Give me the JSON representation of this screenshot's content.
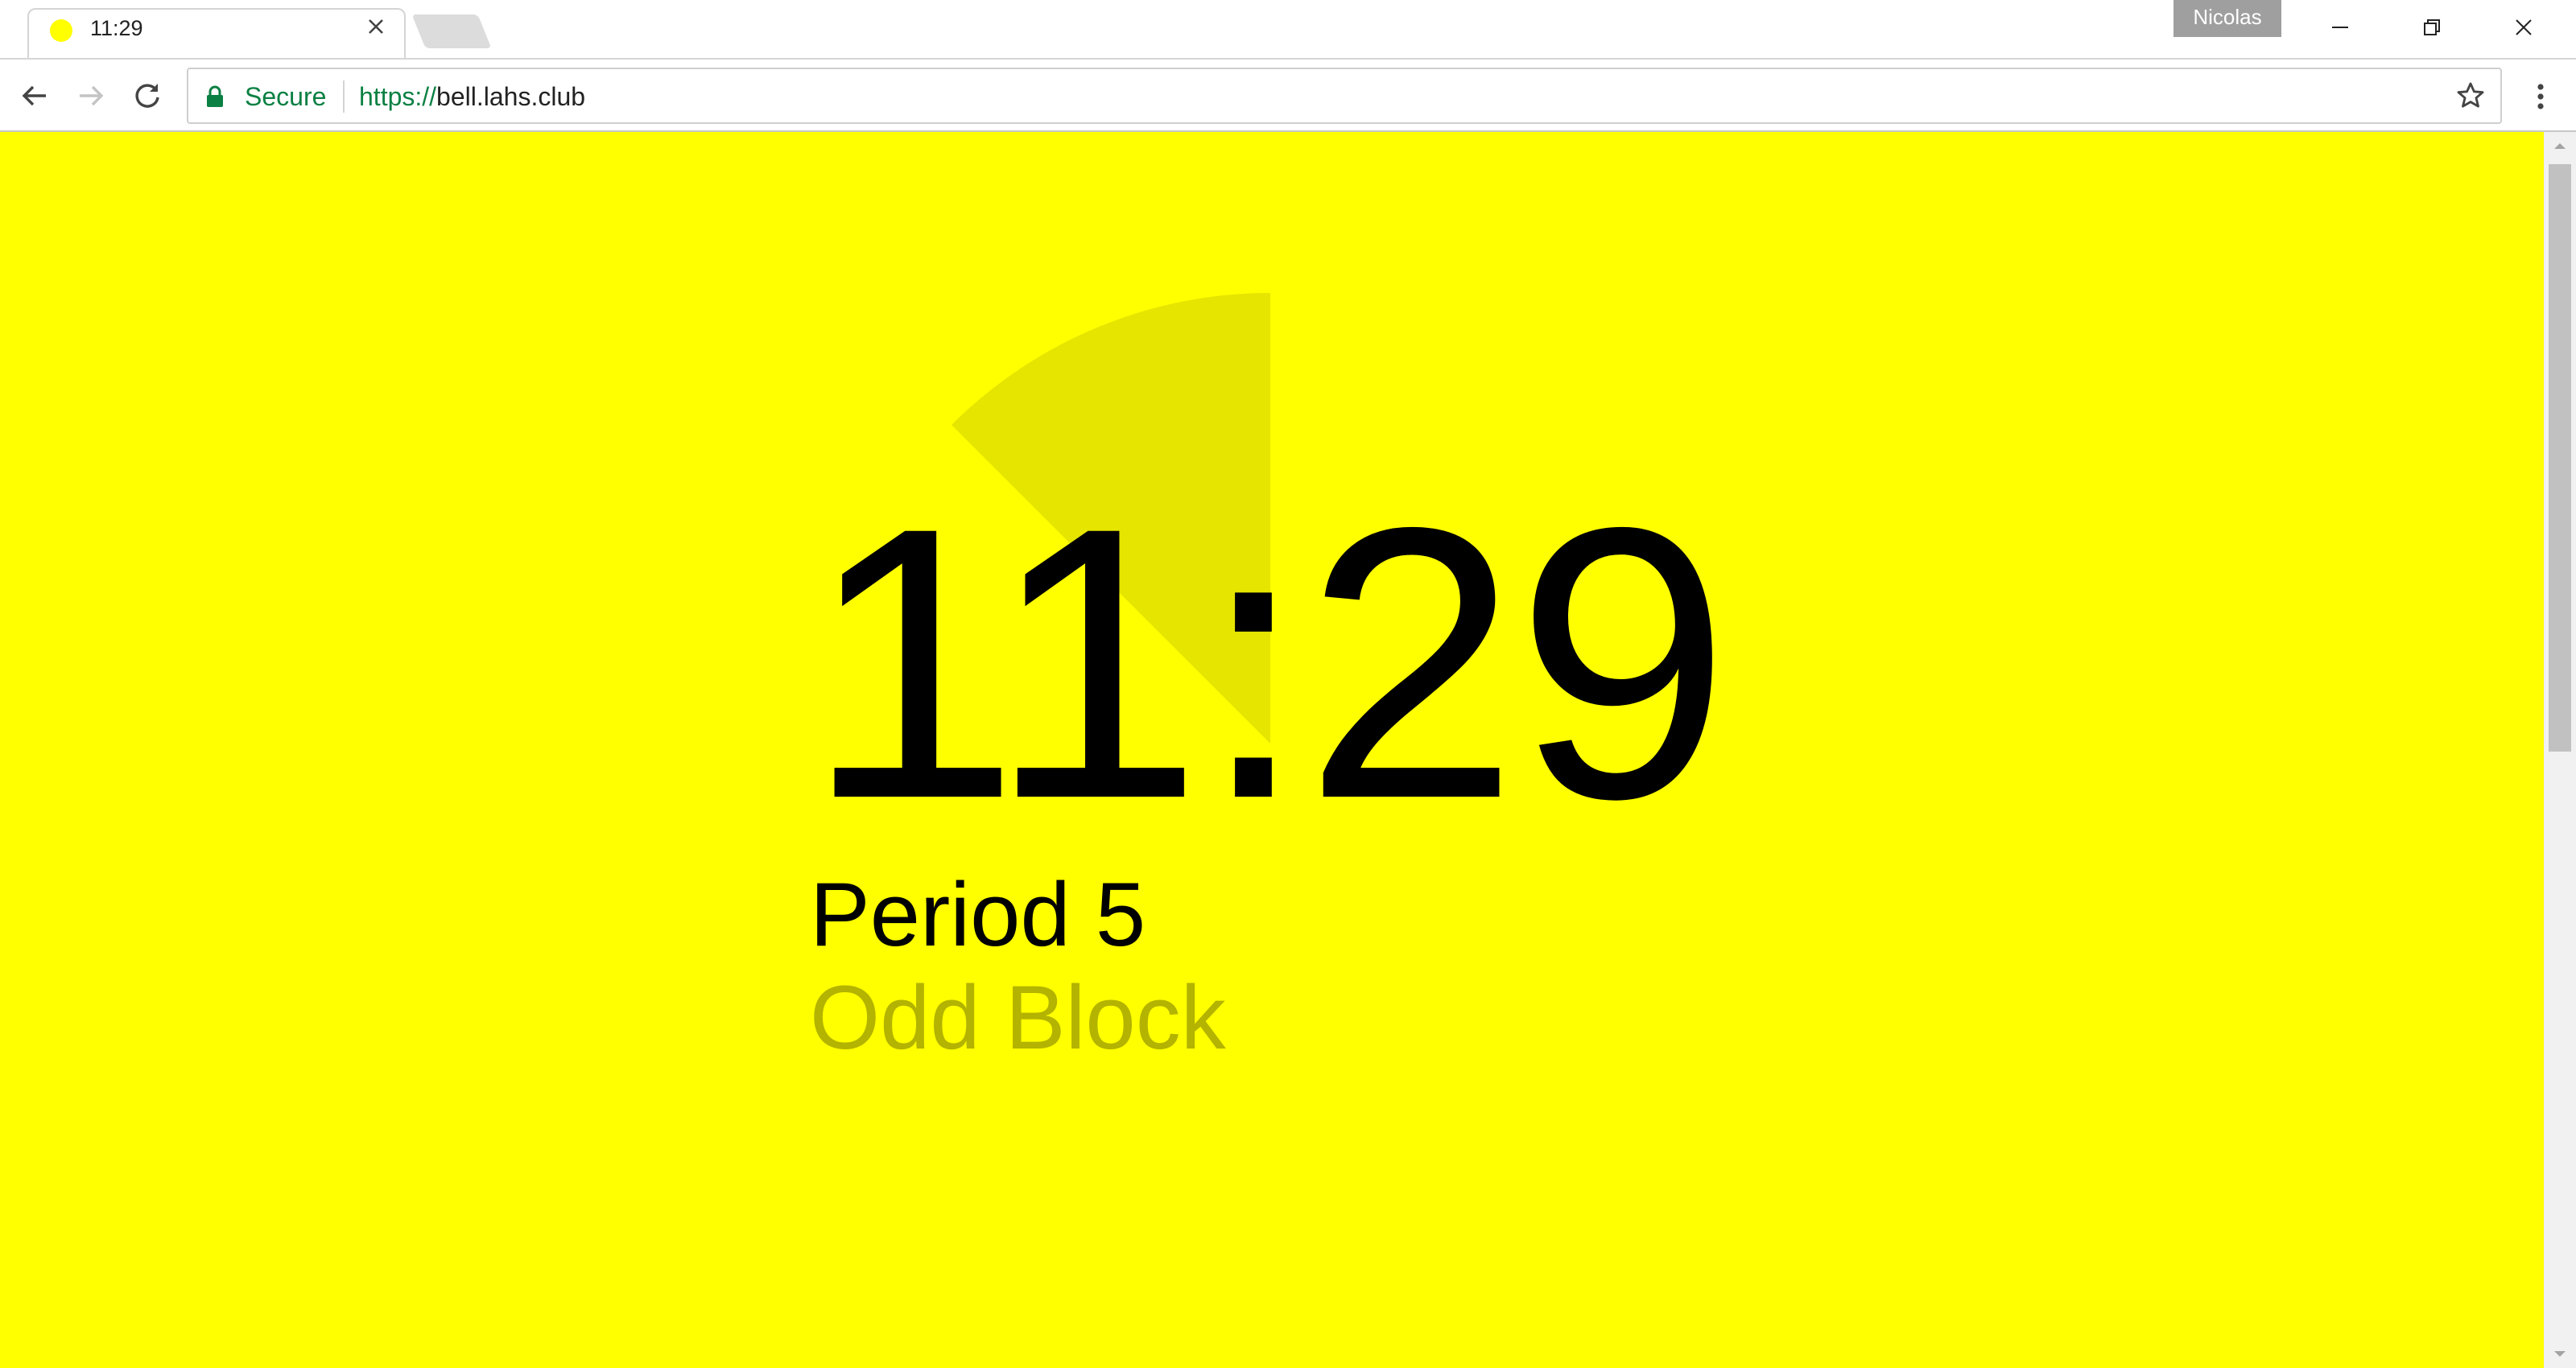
{
  "browser": {
    "tab": {
      "title": "11:29",
      "favicon": "yellow-circle-icon",
      "close_icon": "close-icon"
    },
    "profile_name": "Nicolas",
    "window_controls": {
      "minimize_icon": "minimize-icon",
      "restore_icon": "restore-icon",
      "close_icon": "close-icon"
    },
    "toolbar": {
      "back_icon": "arrow-left-icon",
      "forward_icon": "arrow-right-icon",
      "reload_icon": "reload-icon",
      "security_label": "Secure",
      "url_scheme": "https://",
      "url_host": "bell.lahs.club",
      "bookmark_icon": "star-icon",
      "menu_icon": "more-vert-icon"
    }
  },
  "page": {
    "background_color": "#ffff00",
    "time": "11:29",
    "period": "Period 5",
    "schedule": "Odd Block",
    "progress_fraction": 0.125,
    "progress_color": "#e5e500",
    "schedule_color": "#b3b300"
  },
  "colors": {
    "secure_green": "#0b8043",
    "scrollbar_thumb": "#c1c1c1"
  }
}
